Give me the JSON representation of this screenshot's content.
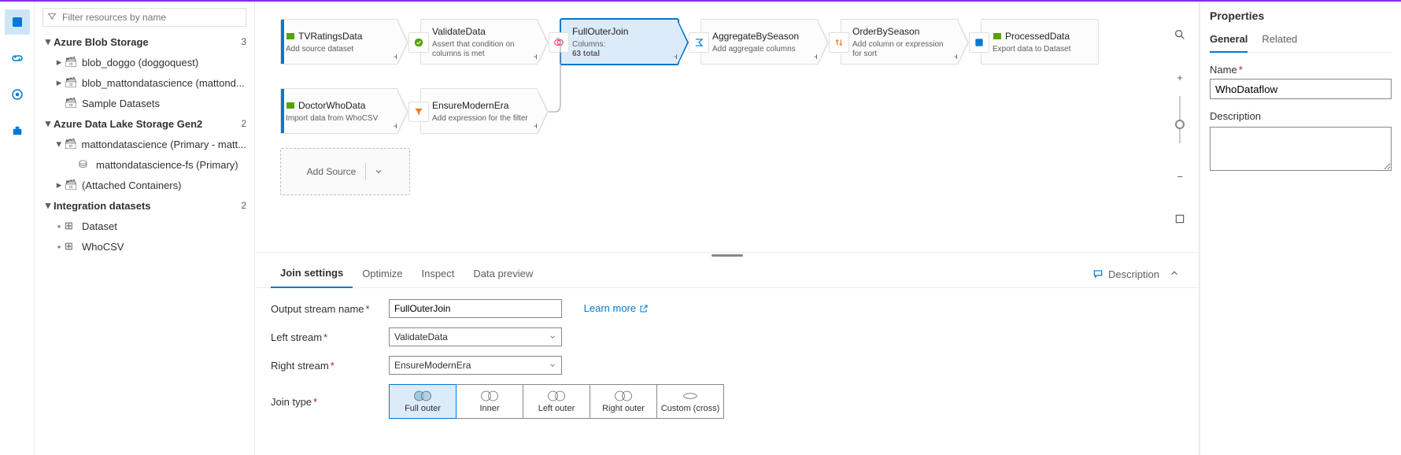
{
  "filter_placeholder": "Filter resources by name",
  "tree": {
    "blob_group": "Azure Blob Storage",
    "blob_count": "3",
    "blob1": "blob_doggo (doggoquest)",
    "blob2": "blob_mattondatascience (mattond...",
    "blob3": "Sample Datasets",
    "adls_group": "Azure Data Lake Storage Gen2",
    "adls_count": "2",
    "adls1": "mattondatascience (Primary - matt...",
    "adls1a": "mattondatascience-fs (Primary)",
    "adls_attached": "(Attached Containers)",
    "intds_group": "Integration datasets",
    "intds_count": "2",
    "intds1": "Dataset",
    "intds2": "WhoCSV"
  },
  "nodes": {
    "tvratings": {
      "title": "TVRatingsData",
      "desc": "Add source dataset"
    },
    "validate": {
      "title": "ValidateData",
      "desc": "Assert that condition on columns is met"
    },
    "fullouter": {
      "title": "FullOuterJoin",
      "desc": "Columns:",
      "desc2": "63 total"
    },
    "aggregate": {
      "title": "AggregateBySeason",
      "desc": "Add aggregate columns"
    },
    "order": {
      "title": "OrderBySeason",
      "desc": "Add column or expression for sort"
    },
    "processed": {
      "title": "ProcessedData",
      "desc": "Export data to Dataset"
    },
    "doctorwho": {
      "title": "DoctorWhoData",
      "desc": "Import data from WhoCSV"
    },
    "ensure": {
      "title": "EnsureModernEra",
      "desc": "Add expression for the filter"
    }
  },
  "addsource": "Add Source",
  "tabs": {
    "joinsettings": "Join settings",
    "optimize": "Optimize",
    "inspect": "Inspect",
    "datapreview": "Data preview",
    "descbtn": "Description"
  },
  "form": {
    "outstream_label": "Output stream name",
    "outstream_value": "FullOuterJoin",
    "learnmore": "Learn more",
    "leftstream_label": "Left stream",
    "leftstream_value": "ValidateData",
    "rightstream_label": "Right stream",
    "rightstream_value": "EnsureModernEra",
    "jointype_label": "Join type",
    "jt_full": "Full outer",
    "jt_inner": "Inner",
    "jt_left": "Left outer",
    "jt_right": "Right outer",
    "jt_cross": "Custom (cross)"
  },
  "props": {
    "title": "Properties",
    "tab_general": "General",
    "tab_related": "Related",
    "name_label": "Name",
    "name_value": "WhoDataflow",
    "desc_label": "Description"
  }
}
